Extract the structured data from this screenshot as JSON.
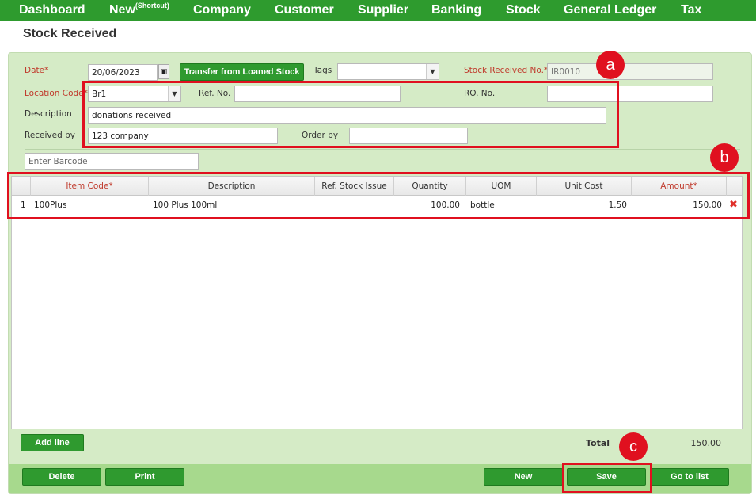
{
  "nav": {
    "items": [
      "Dashboard",
      "New",
      "Company",
      "Customer",
      "Supplier",
      "Banking",
      "Stock",
      "General Ledger",
      "Tax"
    ],
    "new_sup": "(Shortcut)"
  },
  "page": {
    "title": "Stock Received"
  },
  "form": {
    "date_label": "Date*",
    "date_value": "20/06/2023",
    "transfer_button": "Transfer from Loaned Stock",
    "tags_label": "Tags",
    "tags_value": "",
    "stock_no_label": "Stock Received No.*",
    "stock_no_value": "IR0010",
    "location_label": "Location Code*",
    "location_value": "Br1",
    "ref_label": "Ref. No.",
    "ref_value": "",
    "ro_label": "RO. No.",
    "ro_value": "",
    "description_label": "Description",
    "description_value": "donations received",
    "received_by_label": "Received by",
    "received_by_value": "123 company",
    "order_by_label": "Order by",
    "order_by_value": "",
    "barcode_placeholder": "Enter Barcode"
  },
  "grid": {
    "headers": [
      "Item Code*",
      "Description",
      "Ref. Stock Issue",
      "Quantity",
      "UOM",
      "Unit Cost",
      "Amount*"
    ],
    "rows": [
      {
        "no": "1",
        "item_code": "100Plus",
        "description": "100 Plus 100ml",
        "ref": "",
        "quantity": "100.00",
        "uom": "bottle",
        "unit_cost": "1.50",
        "amount": "150.00"
      }
    ]
  },
  "footer": {
    "add_line": "Add line",
    "total_label": "Total",
    "total_value": "150.00",
    "delete": "Delete",
    "print": "Print",
    "new": "New",
    "save": "Save",
    "go_to_list": "Go to list"
  },
  "annotations": {
    "a": "a",
    "b": "b",
    "c": "c"
  },
  "colors": {
    "nav_green": "#2e9b2e",
    "panel_green": "#d5ebc6",
    "button_green": "#2f9a2f",
    "annotation_red": "#e0101f"
  }
}
